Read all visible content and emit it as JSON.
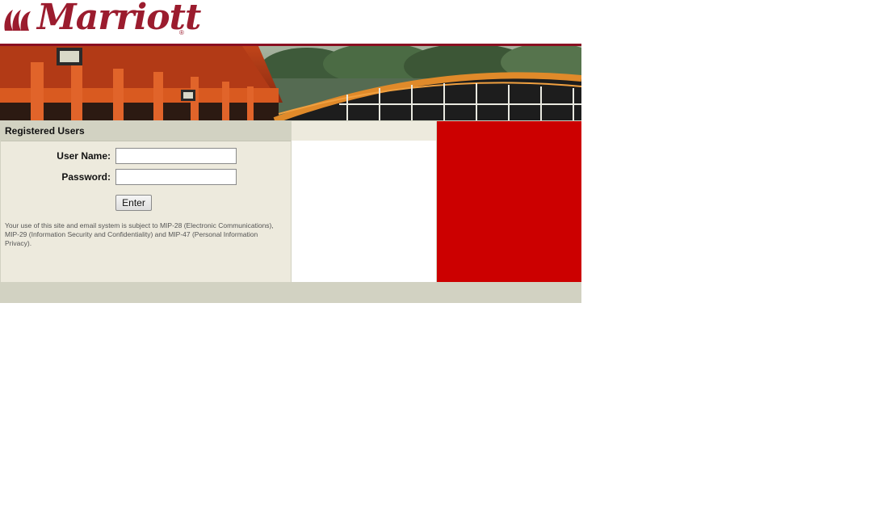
{
  "brand": {
    "name": "Marriott",
    "registered_mark": "®",
    "color": "#9b1c2e"
  },
  "login": {
    "heading": "Registered Users",
    "username_label": "User Name:",
    "password_label": "Password:",
    "username_value": "",
    "password_value": "",
    "enter_label": "Enter",
    "notice": "Your use of this site and email system is subject to MIP-28 (Electronic Communications), MIP-29 (Information Security and Confidentiality) and MIP-47 (Personal Information Privacy)."
  },
  "colors": {
    "panel_bg": "#edeadd",
    "panel_header": "#d2d2c2",
    "accent_red": "#cc0000",
    "banner_line": "#8a1022"
  }
}
